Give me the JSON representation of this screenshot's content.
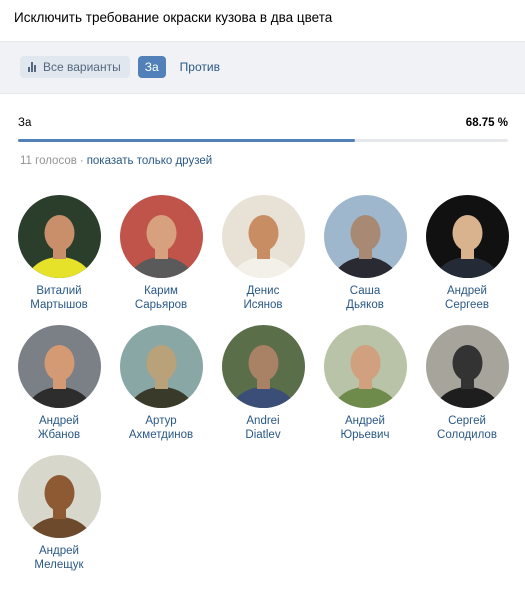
{
  "poll": {
    "question": "Исключить требование окраски кузова в два цвета"
  },
  "filters": {
    "all_label": "Все варианты",
    "for_label": "За",
    "against_label": "Против"
  },
  "result": {
    "option_label": "За",
    "percent_text": "68.75 %",
    "percent": 68.75
  },
  "meta": {
    "votes_text": "11 голосов",
    "separator": "·",
    "friends_link": "показать только друзей"
  },
  "voters": [
    {
      "first": "Виталий",
      "last": "Мартышов",
      "bg": "#2b3e2c",
      "skin": "#c98f6b",
      "shirt": "#e6e22a"
    },
    {
      "first": "Карим",
      "last": "Сарьяров",
      "bg": "#c0534a",
      "skin": "#d7a180",
      "shirt": "#5a5a5a"
    },
    {
      "first": "Денис",
      "last": "Исянов",
      "bg": "#e8e1d6",
      "skin": "#c88d63",
      "shirt": "#f3f0ea"
    },
    {
      "first": "Саша",
      "last": "Дьяков",
      "bg": "#9fb7cc",
      "skin": "#a88a74",
      "shirt": "#2a2a32"
    },
    {
      "first": "Андрей",
      "last": "Сергеев",
      "bg": "#111111",
      "skin": "#d9b28e",
      "shirt": "#242a36"
    },
    {
      "first": "Андрей",
      "last": "Жбанов",
      "bg": "#7b7f86",
      "skin": "#d49a74",
      "shirt": "#2d2d2d"
    },
    {
      "first": "Артур",
      "last": "Ахметдинов",
      "bg": "#89a7a5",
      "skin": "#b9a27a",
      "shirt": "#3a3a2a"
    },
    {
      "first": "Andrei",
      "last": "Diatlev",
      "bg": "#5a6e4a",
      "skin": "#a98164",
      "shirt": "#3a4e78"
    },
    {
      "first": "Андрей",
      "last": "Юрьевич",
      "bg": "#b8c3a8",
      "skin": "#d1a07f",
      "shirt": "#6f8b4c"
    },
    {
      "first": "Сергей",
      "last": "Солодилов",
      "bg": "#a7a49c",
      "skin": "#333333",
      "shirt": "#1e1e1e"
    },
    {
      "first": "Андрей",
      "last": "Мелещук",
      "bg": "#d8d7cc",
      "skin": "#8d5a34",
      "shirt": "#6d4a2c"
    }
  ]
}
